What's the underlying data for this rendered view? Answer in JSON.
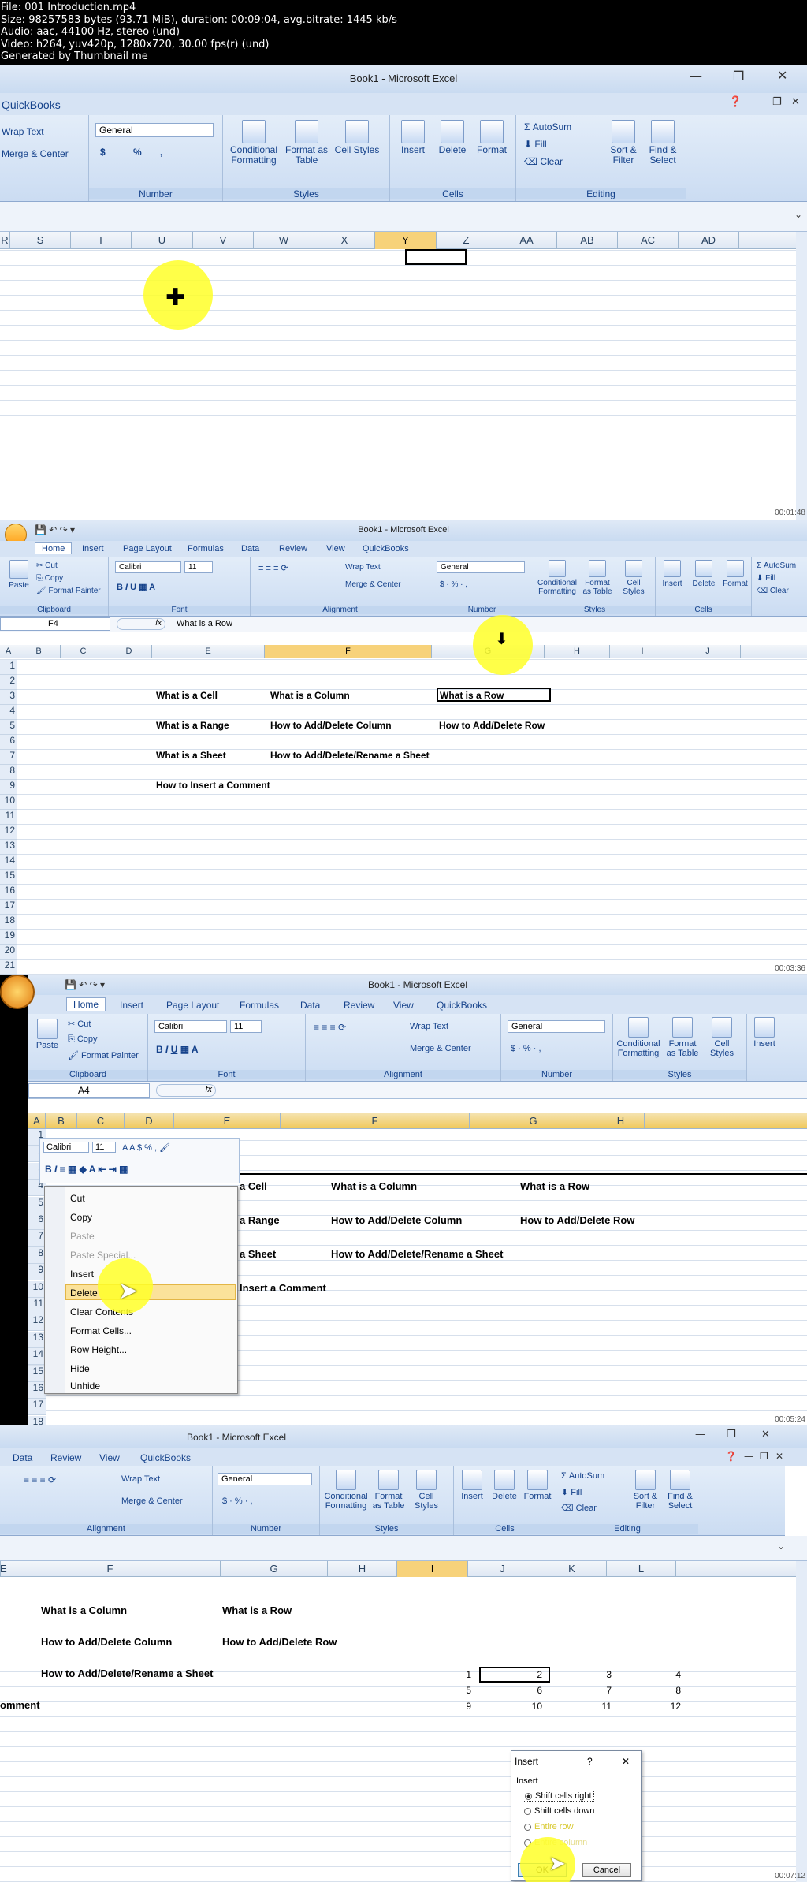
{
  "info": {
    "line1": "File: 001 Introduction.mp4",
    "line2": "Size: 98257583 bytes (93.71 MiB), duration: 00:09:04, avg.bitrate: 1445 kb/s",
    "line3": "Audio: aac, 44100 Hz, stereo (und)",
    "line4": "Video: h264, yuv420p, 1280x720, 30.00 fps(r) (und)",
    "line5": "Generated by Thumbnail me"
  },
  "f1": {
    "title": "Book1 - Microsoft Excel",
    "quickbooks": "QuickBooks",
    "wrap": "Wrap Text",
    "merge": "Merge & Center",
    "numfmt": "General",
    "dollar": "$",
    "pct": "%",
    "comma": ",",
    "number": "Number",
    "cond": "Conditional Formatting",
    "asTable": "Format as Table",
    "cellStyles": "Cell Styles",
    "styles": "Styles",
    "insert": "Insert",
    "delete": "Delete",
    "format": "Format",
    "cells": "Cells",
    "autosum": "AutoSum",
    "fill": "Fill",
    "clear": "Clear",
    "sort": "Sort & Filter",
    "find": "Find & Select",
    "editing": "Editing",
    "cols": [
      "R",
      "S",
      "T",
      "U",
      "V",
      "W",
      "X",
      "Y",
      "Z",
      "AA",
      "AB",
      "AC",
      "AD"
    ],
    "timestamp": "00:01:48"
  },
  "f2": {
    "title": "Book1 - Microsoft Excel",
    "tabs": [
      "Home",
      "Insert",
      "Page Layout",
      "Formulas",
      "Data",
      "Review",
      "View",
      "QuickBooks"
    ],
    "cut": "Cut",
    "copy": "Copy",
    "painter": "Format Painter",
    "paste": "Paste",
    "clipboard": "Clipboard",
    "font": "Calibri",
    "size": "11",
    "fontGroup": "Font",
    "wrap": "Wrap Text",
    "merge": "Merge & Center",
    "alignment": "Alignment",
    "numfmt": "General",
    "number": "Number",
    "cond": "Conditional Formatting",
    "asTable": "Format as Table",
    "cellStyles": "Cell Styles",
    "styles": "Styles",
    "insert": "Insert",
    "delete": "Delete",
    "format": "Format",
    "cells": "Cells",
    "autosum": "AutoSum",
    "fill": "Fill",
    "clear": "Clear",
    "namebox": "F4",
    "formula": "What is a Row",
    "cols": [
      "A",
      "B",
      "C",
      "D",
      "E",
      "F",
      "G",
      "H",
      "I",
      "J"
    ],
    "rows": [
      "1",
      "2",
      "3",
      "4",
      "5",
      "6",
      "7",
      "8",
      "9",
      "10",
      "11",
      "12",
      "13",
      "14",
      "15",
      "16",
      "17",
      "18",
      "19",
      "20",
      "21"
    ],
    "d4": "What is a Cell",
    "e4": "What is a Column",
    "f4": "What is a Row",
    "d6": "What is a Range",
    "e6": "How to Add/Delete Column",
    "f6": "How to Add/Delete Row",
    "d8": "What is a Sheet",
    "e8": "How to Add/Delete/Rename a Sheet",
    "d10": "How to Insert a Comment",
    "timestamp": "00:03:36"
  },
  "f3": {
    "title": "Book1 - Microsoft Excel",
    "tabs": [
      "Home",
      "Insert",
      "Page Layout",
      "Formulas",
      "Data",
      "Review",
      "View",
      "QuickBooks"
    ],
    "cut": "Cut",
    "copy": "Copy",
    "painter": "Format Painter",
    "paste": "Paste",
    "clipboard": "Clipboard",
    "font": "Calibri",
    "size": "11",
    "fontGroup": "Font",
    "wrap": "Wrap Text",
    "merge": "Merge & Center",
    "alignment": "Alignment",
    "numfmt": "General",
    "number": "Number",
    "cond": "Conditional Formatting",
    "asTable": "Format as Table",
    "cellStyles": "Cell Styles",
    "styles": "Styles",
    "insert": "Insert",
    "namebox": "A4",
    "cols": [
      "A",
      "B",
      "C",
      "D",
      "E",
      "F",
      "G",
      "H"
    ],
    "rows": [
      "1",
      "2",
      "3",
      "4",
      "5",
      "6",
      "7",
      "8",
      "9",
      "10",
      "11",
      "12",
      "13",
      "14",
      "15",
      "16",
      "17",
      "18"
    ],
    "d5": "a Cell",
    "e5": "What is a Column",
    "f5": "What is a Row",
    "d7": "a Range",
    "e7": "How to Add/Delete Column",
    "f7": "How to Add/Delete Row",
    "d9": "a Sheet",
    "e9": "How to Add/Delete/Rename a Sheet",
    "d11": "Insert a Comment",
    "mini": {
      "font": "Calibri",
      "size": "11"
    },
    "menu": [
      "Cut",
      "Copy",
      "Paste",
      "Paste Special...",
      "Insert",
      "Delete",
      "Clear Contents",
      "Format Cells...",
      "Row Height...",
      "Hide",
      "Unhide"
    ],
    "timestamp": "00:05:24"
  },
  "f4": {
    "title": "Book1 - Microsoft Excel",
    "tabs": [
      "Data",
      "Review",
      "View",
      "QuickBooks"
    ],
    "wrap": "Wrap Text",
    "merge": "Merge & Center",
    "alignment": "Alignment",
    "numfmt": "General",
    "number": "Number",
    "cond": "Conditional Formatting",
    "asTable": "Format as Table",
    "cellStyles": "Cell Styles",
    "styles": "Styles",
    "insert": "Insert",
    "delete": "Delete",
    "format": "Format",
    "cells": "Cells",
    "autosum": "AutoSum",
    "fill": "Fill",
    "clear": "Clear",
    "sort": "Sort & Filter",
    "find": "Find & Select",
    "editing": "Editing",
    "cols": [
      "E",
      "F",
      "G",
      "H",
      "I",
      "J",
      "K",
      "L"
    ],
    "e4": "What is a Column",
    "f4": "What is a Row",
    "e6": "How to Add/Delete Column",
    "f6": "How to Add/Delete Row",
    "e8": "How to Add/Delete/Rename a Sheet",
    "d10": "omment",
    "nums": [
      [
        "1",
        "2",
        "3",
        "4"
      ],
      [
        "5",
        "6",
        "7",
        "8"
      ],
      [
        "9",
        "10",
        "11",
        "12"
      ]
    ],
    "dialog": {
      "title": "Insert",
      "help": "?",
      "close": "✕",
      "group": "Insert",
      "opt1": "Shift cells right",
      "opt2": "Shift cells down",
      "opt3": "Entire row",
      "opt4": "Entire column",
      "ok": "OK",
      "cancel": "Cancel"
    },
    "timestamp": "00:07:12"
  }
}
